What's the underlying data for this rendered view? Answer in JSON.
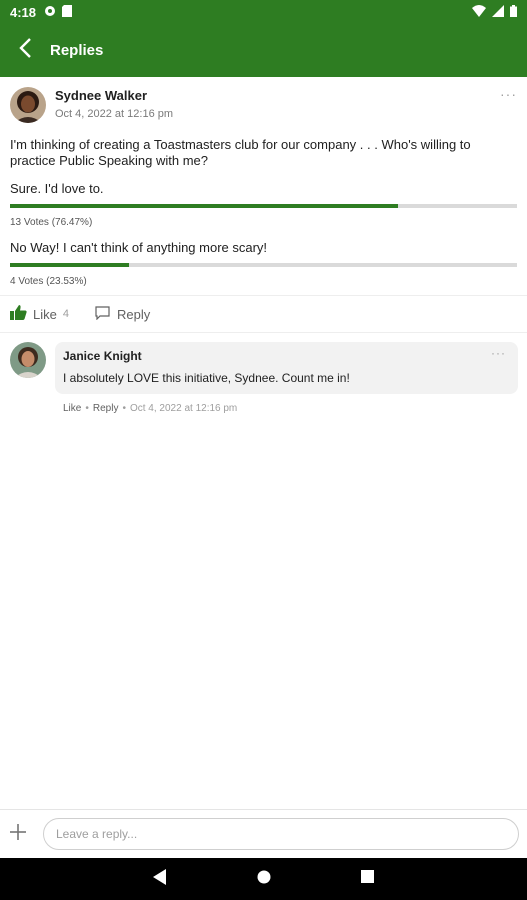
{
  "status_bar": {
    "time": "4:18",
    "left_icons": [
      "data-saver-icon",
      "sd-card-icon"
    ],
    "right_icons": [
      "wifi-icon",
      "signal-icon",
      "battery-icon"
    ]
  },
  "app_bar": {
    "title": "Replies",
    "back_icon": "back-arrow-icon",
    "color": "#2e7d22"
  },
  "post": {
    "author": "Sydnee Walker",
    "timestamp": "Oct 4, 2022 at 12:16 pm",
    "more_label": "···",
    "question": "I'm thinking of creating a Toastmasters club for our company . . . Who's willing to practice Public Speaking with me?",
    "poll": [
      {
        "option": "Sure. I'd love to.",
        "votes_label": "13 Votes (76.47%)",
        "percent": 76.47
      },
      {
        "option": "No Way! I can't think of anything more scary!",
        "votes_label": "4 Votes (23.53%)",
        "percent": 23.53
      }
    ],
    "actions": {
      "like_label": "Like",
      "like_count": "4",
      "reply_label": "Reply"
    }
  },
  "comment": {
    "author": "Janice Knight",
    "text": "I absolutely LOVE this initiative, Sydnee.  Count me in!",
    "more_label": "···",
    "like_label": "Like",
    "separator": "•",
    "reply_label": "Reply",
    "timestamp": "Oct 4, 2022 at 12:16 pm"
  },
  "reply_bar": {
    "placeholder": "Leave a reply..."
  },
  "accent_color": "#2e7d22"
}
